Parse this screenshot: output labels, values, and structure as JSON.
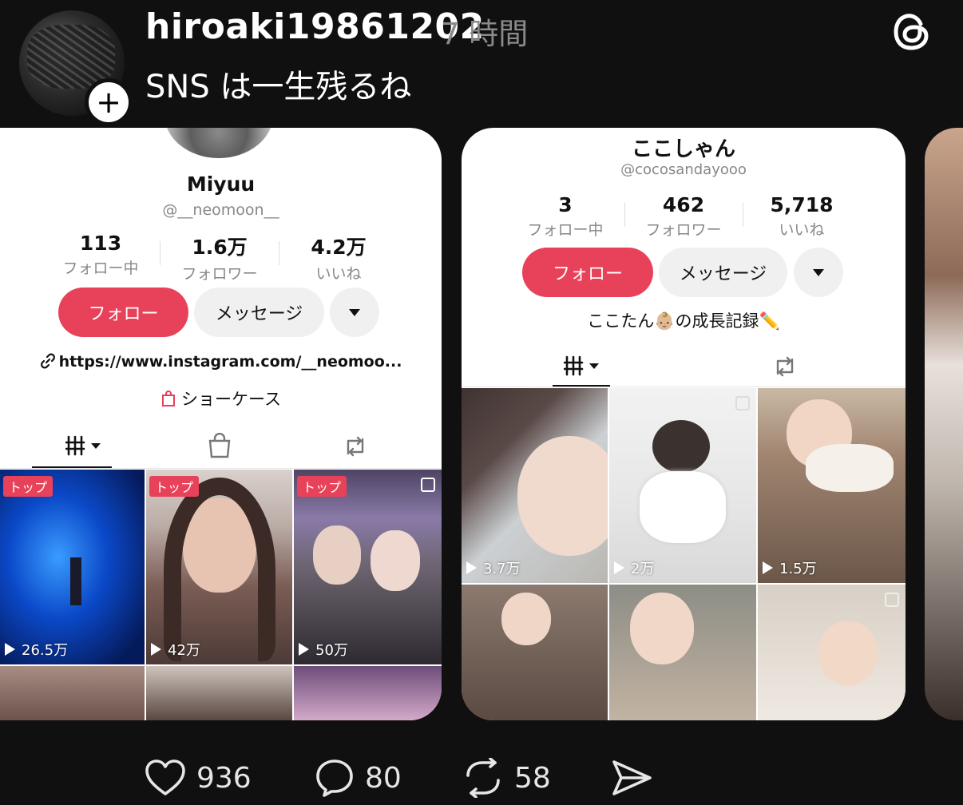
{
  "post": {
    "username": "hiroaki19861202",
    "time": "7 時間",
    "text": "SNS は一生残るね",
    "add_icon": "plus-icon",
    "brand_icon": "threads-logo-icon"
  },
  "card1": {
    "name": "Miyuu",
    "handle": "@__neomoon__",
    "stats": [
      {
        "num": "113",
        "label": "フォロー中"
      },
      {
        "num": "1.6万",
        "label": "フォロワー"
      },
      {
        "num": "4.2万",
        "label": "いいね"
      }
    ],
    "follow_label": "フォロー",
    "message_label": "メッセージ",
    "link": "https://www.instagram.com/__neomoo...",
    "showcase": "ショーケース",
    "videos": [
      {
        "badge": "トップ",
        "views": "26.5万"
      },
      {
        "badge": "トップ",
        "views": "42万"
      },
      {
        "badge": "トップ",
        "views": "50万"
      }
    ]
  },
  "card2": {
    "name": "ここしゃん",
    "handle": "@cocosandayooo",
    "stats": [
      {
        "num": "3",
        "label": "フォロー中"
      },
      {
        "num": "462",
        "label": "フォロワー"
      },
      {
        "num": "5,718",
        "label": "いいね"
      }
    ],
    "follow_label": "フォロー",
    "message_label": "メッセージ",
    "bio": "ここたん👶🏼の成長記録✏️",
    "videos": [
      {
        "views": "3.7万"
      },
      {
        "views": "2万"
      },
      {
        "views": "1.5万"
      }
    ]
  },
  "actions": {
    "likes": "936",
    "comments": "80",
    "reposts": "58"
  },
  "colors": {
    "accent": "#e8425a",
    "background": "#101010"
  }
}
